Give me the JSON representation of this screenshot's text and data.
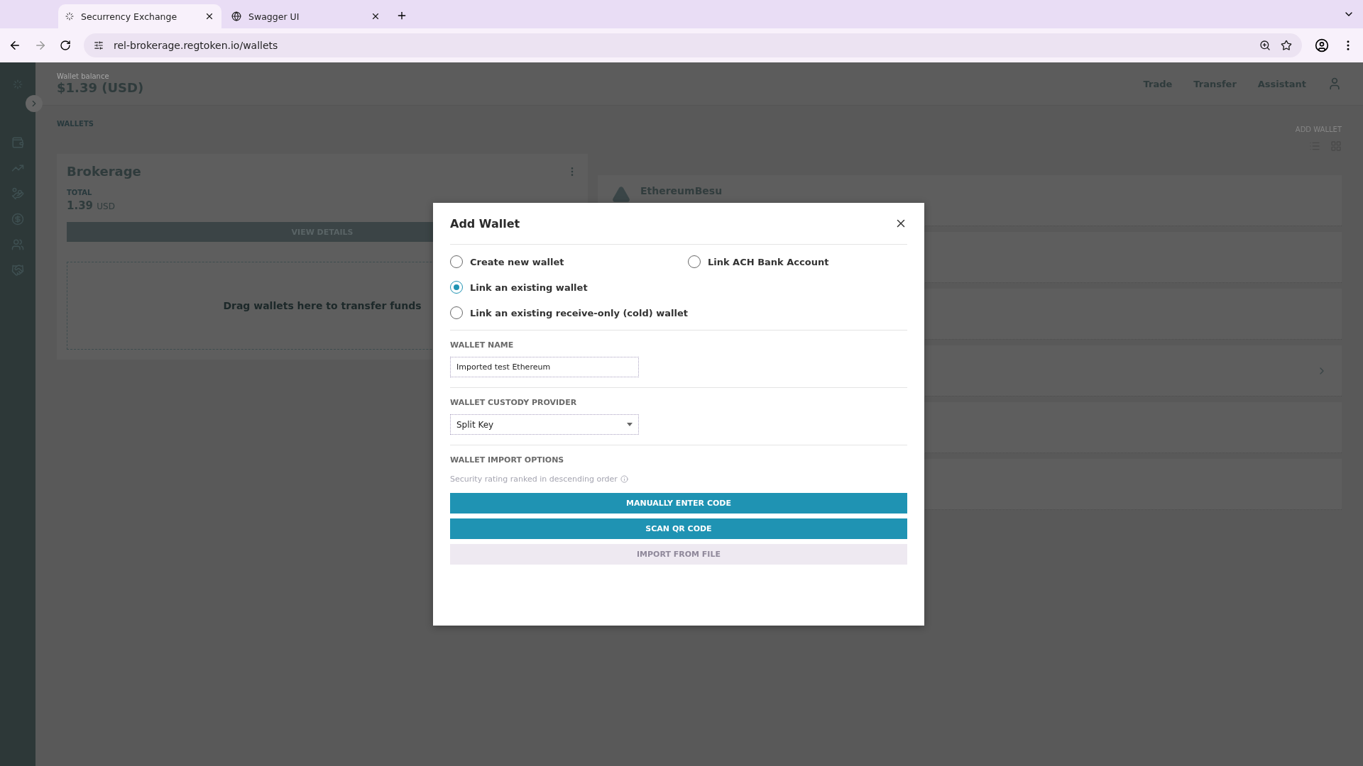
{
  "browser": {
    "tabs": [
      {
        "title": "Securrency Exchange",
        "selected": true,
        "kind": "spinner"
      },
      {
        "title": "Swagger UI",
        "selected": false,
        "kind": "globe"
      }
    ],
    "url": "rel-brokerage.regtoken.io/wallets"
  },
  "header": {
    "balance_label": "Wallet balance",
    "balance": "$1.39 (USD)",
    "nav": [
      "Trade",
      "Transfer",
      "Assistant"
    ]
  },
  "wallets": {
    "title": "WALLETS",
    "add_wallet": "ADD WALLET",
    "card": {
      "title": "Brokerage",
      "total_label": "TOTAL",
      "amount": "1.39",
      "currency": "USD",
      "button": "VIEW DETAILS",
      "drop_hint": "Drag wallets here to transfer funds"
    },
    "rows": [
      {
        "name": "EthereumBesu"
      }
    ]
  },
  "dialog": {
    "title": "Add Wallet",
    "options": [
      {
        "label": "Create new wallet",
        "selected": false
      },
      {
        "label": "Link an existing wallet",
        "selected": true
      },
      {
        "label": "Link an existing receive-only (cold) wallet",
        "selected": false
      },
      {
        "label": "Link ACH Bank Account",
        "selected": false
      }
    ],
    "wallet_name": {
      "label": "WALLET NAME",
      "value": "Imported test Ethereum"
    },
    "custody_provider": {
      "label": "WALLET CUSTODY PROVIDER",
      "value": "Split Key"
    },
    "import_options": {
      "label": "WALLET IMPORT OPTIONS",
      "hint": "Security rating ranked in descending order",
      "buttons": [
        {
          "label": "MANUALLY ENTER CODE",
          "disabled": false
        },
        {
          "label": "SCAN QR CODE",
          "disabled": false
        },
        {
          "label": "IMPORT FROM FILE",
          "disabled": true
        }
      ]
    }
  }
}
